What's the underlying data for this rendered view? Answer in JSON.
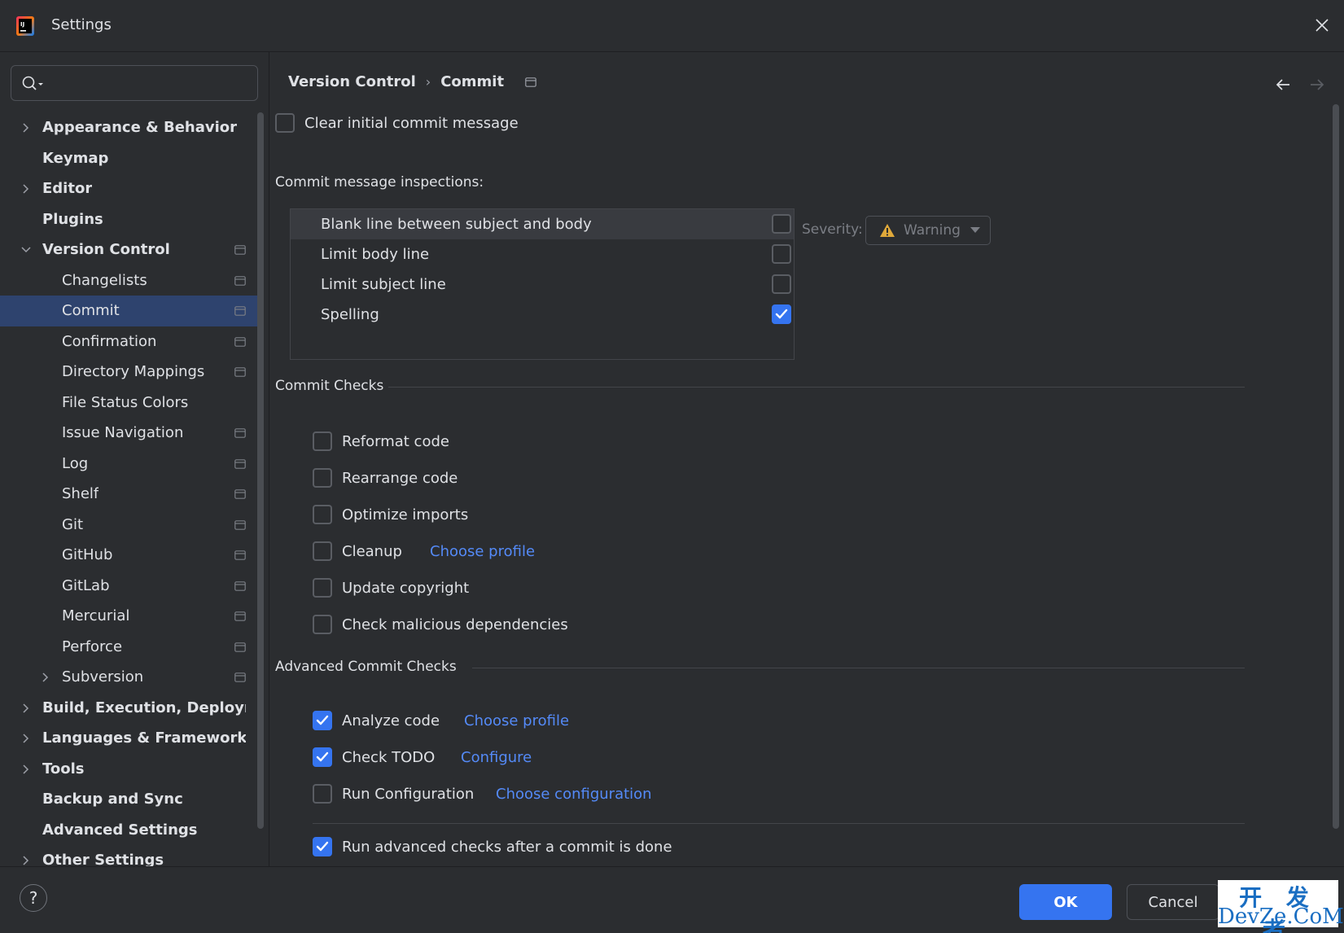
{
  "window": {
    "title": "Settings"
  },
  "search": {
    "placeholder": ""
  },
  "sidebar": {
    "items": [
      {
        "label": "Appearance & Behavior",
        "level": 0,
        "bold": true,
        "expandable": true,
        "expanded": false,
        "project": false,
        "selected": false
      },
      {
        "label": "Keymap",
        "level": 0,
        "bold": true,
        "expandable": false,
        "expanded": false,
        "project": false,
        "selected": false
      },
      {
        "label": "Editor",
        "level": 0,
        "bold": true,
        "expandable": true,
        "expanded": false,
        "project": false,
        "selected": false
      },
      {
        "label": "Plugins",
        "level": 0,
        "bold": true,
        "expandable": false,
        "expanded": false,
        "project": false,
        "selected": false
      },
      {
        "label": "Version Control",
        "level": 0,
        "bold": true,
        "expandable": true,
        "expanded": true,
        "project": true,
        "selected": false
      },
      {
        "label": "Changelists",
        "level": 1,
        "bold": false,
        "expandable": false,
        "expanded": false,
        "project": true,
        "selected": false
      },
      {
        "label": "Commit",
        "level": 1,
        "bold": false,
        "expandable": false,
        "expanded": false,
        "project": true,
        "selected": true
      },
      {
        "label": "Confirmation",
        "level": 1,
        "bold": false,
        "expandable": false,
        "expanded": false,
        "project": true,
        "selected": false
      },
      {
        "label": "Directory Mappings",
        "level": 1,
        "bold": false,
        "expandable": false,
        "expanded": false,
        "project": true,
        "selected": false
      },
      {
        "label": "File Status Colors",
        "level": 1,
        "bold": false,
        "expandable": false,
        "expanded": false,
        "project": false,
        "selected": false
      },
      {
        "label": "Issue Navigation",
        "level": 1,
        "bold": false,
        "expandable": false,
        "expanded": false,
        "project": true,
        "selected": false
      },
      {
        "label": "Log",
        "level": 1,
        "bold": false,
        "expandable": false,
        "expanded": false,
        "project": true,
        "selected": false
      },
      {
        "label": "Shelf",
        "level": 1,
        "bold": false,
        "expandable": false,
        "expanded": false,
        "project": true,
        "selected": false
      },
      {
        "label": "Git",
        "level": 1,
        "bold": false,
        "expandable": false,
        "expanded": false,
        "project": true,
        "selected": false
      },
      {
        "label": "GitHub",
        "level": 1,
        "bold": false,
        "expandable": false,
        "expanded": false,
        "project": true,
        "selected": false
      },
      {
        "label": "GitLab",
        "level": 1,
        "bold": false,
        "expandable": false,
        "expanded": false,
        "project": true,
        "selected": false
      },
      {
        "label": "Mercurial",
        "level": 1,
        "bold": false,
        "expandable": false,
        "expanded": false,
        "project": true,
        "selected": false
      },
      {
        "label": "Perforce",
        "level": 1,
        "bold": false,
        "expandable": false,
        "expanded": false,
        "project": true,
        "selected": false
      },
      {
        "label": "Subversion",
        "level": 1,
        "bold": false,
        "expandable": true,
        "expanded": false,
        "project": true,
        "selected": false
      },
      {
        "label": "Build, Execution, Deployment",
        "level": 0,
        "bold": true,
        "expandable": true,
        "expanded": false,
        "project": false,
        "selected": false
      },
      {
        "label": "Languages & Frameworks",
        "level": 0,
        "bold": true,
        "expandable": true,
        "expanded": false,
        "project": false,
        "selected": false
      },
      {
        "label": "Tools",
        "level": 0,
        "bold": true,
        "expandable": true,
        "expanded": false,
        "project": false,
        "selected": false
      },
      {
        "label": "Backup and Sync",
        "level": 0,
        "bold": true,
        "expandable": false,
        "expanded": false,
        "project": false,
        "selected": false
      },
      {
        "label": "Advanced Settings",
        "level": 0,
        "bold": true,
        "expandable": false,
        "expanded": false,
        "project": false,
        "selected": false
      },
      {
        "label": "Other Settings",
        "level": 0,
        "bold": true,
        "expandable": true,
        "expanded": false,
        "project": false,
        "selected": false
      }
    ]
  },
  "breadcrumb": {
    "parent": "Version Control",
    "separator": "›",
    "current": "Commit"
  },
  "main": {
    "clear_initial": {
      "label": "Clear initial commit message",
      "checked": false
    },
    "inspections": {
      "title": "Commit message inspections:",
      "rows": [
        {
          "label": "Blank line between subject and body",
          "checked": false,
          "selected": true
        },
        {
          "label": "Limit body line",
          "checked": false,
          "selected": false
        },
        {
          "label": "Limit subject line",
          "checked": false,
          "selected": false
        },
        {
          "label": "Spelling",
          "checked": true,
          "selected": false
        }
      ],
      "severity_label": "Severity:",
      "severity_value": "Warning"
    },
    "commit_checks": {
      "title": "Commit Checks",
      "items": [
        {
          "label": "Reformat code",
          "checked": false,
          "link": ""
        },
        {
          "label": "Rearrange code",
          "checked": false,
          "link": ""
        },
        {
          "label": "Optimize imports",
          "checked": false,
          "link": ""
        },
        {
          "label": "Cleanup",
          "checked": false,
          "link": "Choose profile"
        },
        {
          "label": "Update copyright",
          "checked": false,
          "link": ""
        },
        {
          "label": "Check malicious dependencies",
          "checked": false,
          "link": ""
        }
      ]
    },
    "advanced_checks": {
      "title": "Advanced Commit Checks",
      "items": [
        {
          "label": "Analyze code",
          "checked": true,
          "link": "Choose profile"
        },
        {
          "label": "Check TODO",
          "checked": true,
          "link": "Configure"
        },
        {
          "label": "Run Configuration",
          "checked": false,
          "link": "Choose configuration"
        }
      ],
      "after_commit": {
        "label": "Run advanced checks after a commit is done",
        "checked": true
      }
    }
  },
  "footer": {
    "help": "?",
    "ok": "OK",
    "cancel": "Cancel"
  },
  "watermark": {
    "line1": "开 发 者",
    "line2": "DevZe.CoM"
  },
  "colors": {
    "accent": "#3574f0",
    "link": "#548af7",
    "selection": "#2e436e",
    "background": "#2b2d30",
    "warning": "#e0a93a"
  }
}
